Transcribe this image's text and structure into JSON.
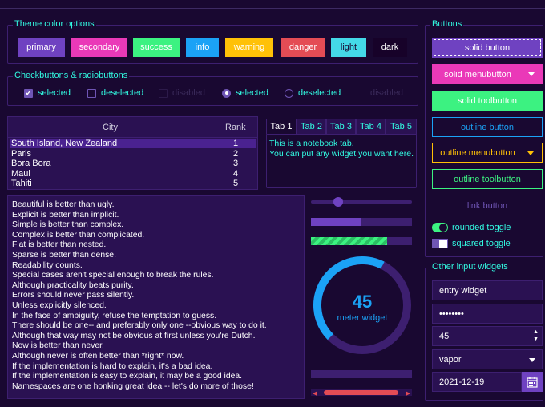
{
  "theme_colors": {
    "title": "Theme color options",
    "items": [
      {
        "label": "primary",
        "color": "#6f42c1"
      },
      {
        "label": "secondary",
        "color": "#ea39b8"
      },
      {
        "label": "success",
        "color": "#3cf281"
      },
      {
        "label": "info",
        "color": "#1ba2f6"
      },
      {
        "label": "warning",
        "color": "#ffc107"
      },
      {
        "label": "danger",
        "color": "#e44c55"
      },
      {
        "label": "light",
        "color": "#44d9e8"
      },
      {
        "label": "dark",
        "color": "#170229"
      }
    ]
  },
  "checks": {
    "title": "Checkbuttons & radiobuttons",
    "items": [
      {
        "label": "selected"
      },
      {
        "label": "deselected"
      },
      {
        "label": "disabled"
      },
      {
        "label": "selected"
      },
      {
        "label": "deselected"
      },
      {
        "label": "disabled"
      }
    ]
  },
  "table": {
    "headers": [
      "City",
      "Rank"
    ],
    "rows": [
      {
        "city": "South Island, New Zealand",
        "rank": "1"
      },
      {
        "city": "Paris",
        "rank": "2"
      },
      {
        "city": "Bora Bora",
        "rank": "3"
      },
      {
        "city": "Maui",
        "rank": "4"
      },
      {
        "city": "Tahiti",
        "rank": "5"
      }
    ]
  },
  "notebook": {
    "tabs": [
      "Tab 1",
      "Tab 2",
      "Tab 3",
      "Tab 4",
      "Tab 5"
    ],
    "content_line1": "This is a notebook tab.",
    "content_line2": "You can put any widget you want here."
  },
  "zen": [
    "Beautiful is better than ugly.",
    "Explicit is better than implicit.",
    "Simple is better than complex.",
    "Complex is better than complicated.",
    "Flat is better than nested.",
    "Sparse is better than dense.",
    "Readability counts.",
    "Special cases aren't special enough to break the rules.",
    "Although practicality beats purity.",
    "Errors should never pass silently.",
    "Unless explicitly silenced.",
    "In the face of ambiguity, refuse the temptation to guess.",
    "There should be one-- and preferably only one --obvious way to do it.",
    "Although that way may not be obvious at first unless you're Dutch.",
    "Now is better than never.",
    "Although never is often better than *right* now.",
    "If the implementation is hard to explain, it's a bad idea.",
    "If the implementation is easy to explain, it may be a good idea.",
    "Namespaces are one honking great idea -- let's do more of those!"
  ],
  "meter": {
    "value": "45",
    "label": "meter widget",
    "fraction": 0.45
  },
  "progress": {
    "bar1_fraction": 0.49,
    "bar2_fraction": 0.75,
    "slider_fraction": 0.27
  },
  "buttons": {
    "title": "Buttons",
    "solid_button": "solid button",
    "solid_menubutton": "solid menubutton",
    "solid_toolbutton": "solid toolbutton",
    "outline_button": "outline button",
    "outline_menubutton": "outline menubutton",
    "outline_toolbutton": "outline toolbutton",
    "link_button": "link button",
    "rounded_toggle": "rounded toggle",
    "squared_toggle": "squared toggle"
  },
  "inputs": {
    "title": "Other input widgets",
    "entry": "entry widget",
    "password": "••••••••",
    "spinbox": "45",
    "combobox": "vapor",
    "date": "2021-12-19"
  }
}
